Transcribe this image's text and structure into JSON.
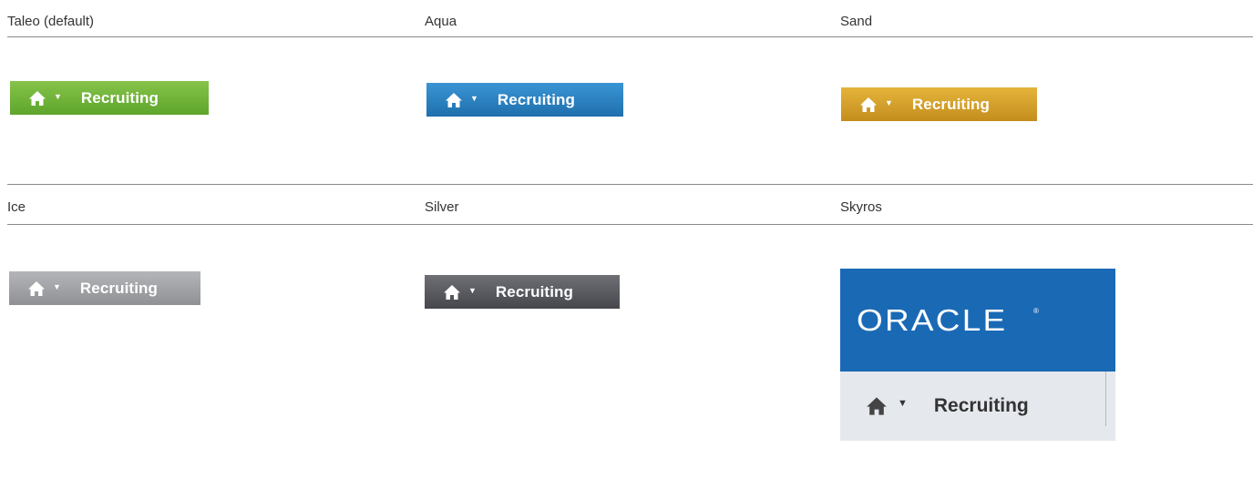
{
  "themes": {
    "taleo": {
      "name": "Taleo (default)",
      "tab_label": "Recruiting",
      "colors": [
        "#86c34a",
        "#5ea52b"
      ]
    },
    "aqua": {
      "name": "Aqua",
      "tab_label": "Recruiting",
      "colors": [
        "#3a95d5",
        "#1f6fac"
      ]
    },
    "sand": {
      "name": "Sand",
      "tab_label": "Recruiting",
      "colors": [
        "#e5b43a",
        "#c48d1e"
      ]
    },
    "ice": {
      "name": "Ice",
      "tab_label": "Recruiting",
      "colors": [
        "#b4b5b8",
        "#8f9194"
      ]
    },
    "silver": {
      "name": "Silver",
      "tab_label": "Recruiting",
      "colors": [
        "#6e7075",
        "#45474c"
      ]
    },
    "skyros": {
      "name": "Skyros",
      "logo_text": "ORACLE",
      "logo_mark": "®",
      "tab_label": "Recruiting",
      "colors": [
        "#1a69b5",
        "#e5e8ed"
      ]
    }
  },
  "icons": {
    "home": "home-icon",
    "caret": "caret-down-icon",
    "caret_glyph": "▼"
  }
}
